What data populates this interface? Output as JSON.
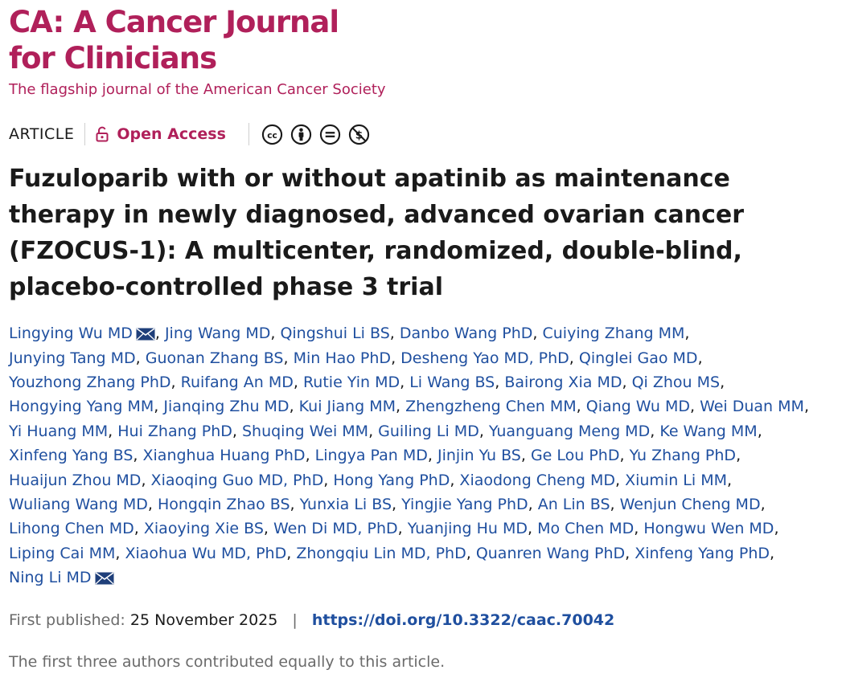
{
  "journal": {
    "title_line1": "CA: A Cancer Journal",
    "title_line2": "for Clinicians",
    "tagline": "The flagship journal of the American Cancer Society"
  },
  "meta": {
    "article_type": "ARTICLE",
    "access_label": "Open Access",
    "license_icons": [
      "cc-icon",
      "by-attribution-icon",
      "noderivs-icon",
      "noncommercial-icon"
    ]
  },
  "article": {
    "title": "Fuzuloparib with or without apatinib as maintenance therapy in newly diagnosed, advanced ovarian cancer (FZOCUS-1): A multicenter, randomized, double-blind, placebo-controlled phase 3 trial"
  },
  "authors": [
    {
      "text": "Lingying Wu MD",
      "email": true
    },
    {
      "text": "Jing Wang MD"
    },
    {
      "text": "Qingshui Li BS"
    },
    {
      "text": "Danbo Wang PhD"
    },
    {
      "text": "Cuiying Zhang MM",
      "break": true
    },
    {
      "text": "Junying Tang MD"
    },
    {
      "text": "Guonan Zhang BS"
    },
    {
      "text": "Min Hao PhD"
    },
    {
      "text": "Desheng Yao MD, PhD"
    },
    {
      "text": "Qinglei Gao MD",
      "break": true
    },
    {
      "text": "Youzhong Zhang PhD"
    },
    {
      "text": "Ruifang An MD"
    },
    {
      "text": "Rutie Yin MD"
    },
    {
      "text": "Li Wang BS"
    },
    {
      "text": "Bairong Xia MD"
    },
    {
      "text": "Qi Zhou MS",
      "break": true
    },
    {
      "text": "Hongying Yang MM"
    },
    {
      "text": "Jianqing Zhu MD"
    },
    {
      "text": "Kui Jiang MM"
    },
    {
      "text": "Zhengzheng Chen MM"
    },
    {
      "text": "Qiang Wu MD"
    },
    {
      "text": "Wei Duan MM",
      "break": true
    },
    {
      "text": "Yi Huang MM"
    },
    {
      "text": "Hui Zhang PhD"
    },
    {
      "text": "Shuqing Wei MM"
    },
    {
      "text": "Guiling Li MD"
    },
    {
      "text": "Yuanguang Meng MD"
    },
    {
      "text": "Ke Wang MM",
      "break": true
    },
    {
      "text": "Xinfeng Yang BS"
    },
    {
      "text": "Xianghua Huang PhD"
    },
    {
      "text": "Lingya Pan MD"
    },
    {
      "text": "Jinjin Yu BS"
    },
    {
      "text": "Ge Lou PhD"
    },
    {
      "text": "Yu Zhang PhD",
      "break": true
    },
    {
      "text": "Huaijun Zhou MD"
    },
    {
      "text": "Xiaoqing Guo MD, PhD"
    },
    {
      "text": "Hong Yang PhD"
    },
    {
      "text": "Xiaodong Cheng MD"
    },
    {
      "text": "Xiumin Li MM",
      "break": true
    },
    {
      "text": "Wuliang Wang MD"
    },
    {
      "text": "Hongqin Zhao BS"
    },
    {
      "text": "Yunxia Li BS"
    },
    {
      "text": "Yingjie Yang PhD"
    },
    {
      "text": "An Lin BS"
    },
    {
      "text": "Wenjun Cheng MD",
      "break": true
    },
    {
      "text": "Lihong Chen MD"
    },
    {
      "text": "Xiaoying Xie BS"
    },
    {
      "text": "Wen Di MD, PhD"
    },
    {
      "text": "Yuanjing Hu MD"
    },
    {
      "text": "Mo Chen MD"
    },
    {
      "text": "Hongwu Wen MD",
      "break": true
    },
    {
      "text": "Liping Cai MM"
    },
    {
      "text": "Xiaohua Wu MD, PhD"
    },
    {
      "text": "Zhongqiu Lin MD, PhD"
    },
    {
      "text": "Quanren Wang PhD"
    },
    {
      "text": "Xinfeng Yang PhD",
      "break": true
    },
    {
      "text": "Ning Li MD",
      "email": true,
      "last": true
    }
  ],
  "publication": {
    "first_published_label": "First published:",
    "first_published_date": "25 November 2025",
    "separator": "|",
    "doi": "https://doi.org/10.3322/caac.70042"
  },
  "note": "The first three authors contributed equally to this article.",
  "colors": {
    "brand": "#b0205a",
    "link": "#1f4f9f",
    "muted": "#6b6b6b",
    "text": "#1a1a1a"
  }
}
